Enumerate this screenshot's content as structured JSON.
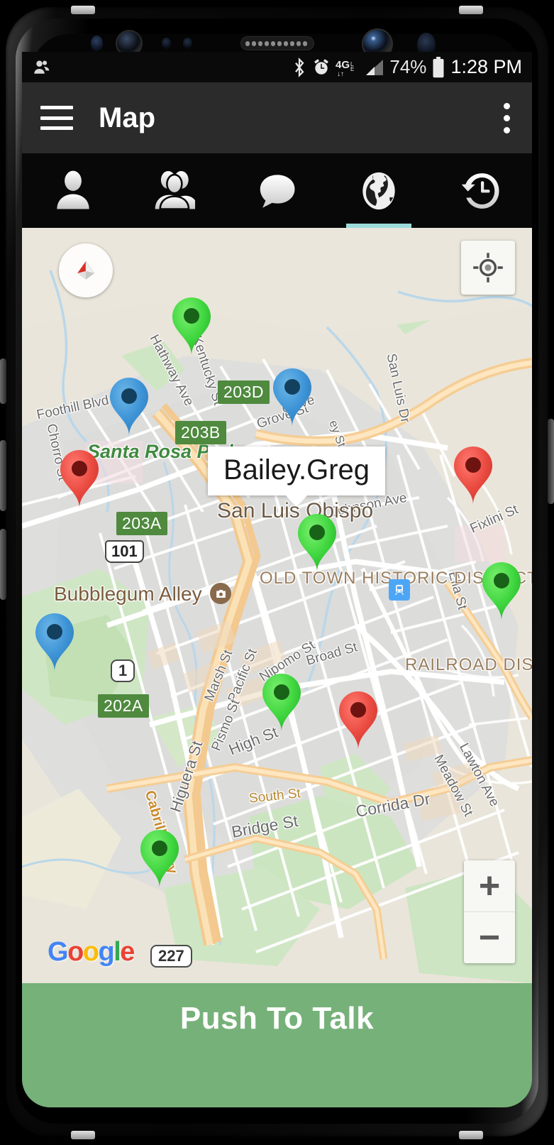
{
  "statusbar": {
    "left_icons": [
      "contacts-icon"
    ],
    "right_icons": [
      "bluetooth-icon",
      "alarm-icon",
      "4g-lte-icon",
      "signal-icon",
      "battery-icon"
    ],
    "network": "4G",
    "battery_percent": "74%",
    "time": "1:28 PM"
  },
  "appbar": {
    "menu_icon": "hamburger-menu-icon",
    "title": "Map",
    "overflow_icon": "overflow-menu-icon"
  },
  "tabs": [
    {
      "name": "person",
      "icon": "person-icon",
      "active": false
    },
    {
      "name": "group",
      "icon": "group-icon",
      "active": false
    },
    {
      "name": "chat",
      "icon": "chat-bubble-icon",
      "active": false
    },
    {
      "name": "map",
      "icon": "globe-icon",
      "active": true
    },
    {
      "name": "history",
      "icon": "history-clock-icon",
      "active": false
    }
  ],
  "map": {
    "info_window": {
      "label": "Bailey.Greg"
    },
    "controls": {
      "compass": "compass-icon",
      "my_location": "my-location-crosshair-icon",
      "zoom_in": "+",
      "zoom_out": "−"
    },
    "attribution": "Google",
    "markers": [
      {
        "color": "green",
        "label": "marker-green-1"
      },
      {
        "color": "blue",
        "label": "marker-blue-1"
      },
      {
        "color": "blue",
        "label": "marker-blue-2"
      },
      {
        "color": "red",
        "label": "marker-red-1"
      },
      {
        "color": "red",
        "label": "marker-red-2"
      },
      {
        "color": "green",
        "label": "marker-green-selected"
      },
      {
        "color": "green",
        "label": "marker-green-2"
      },
      {
        "color": "blue",
        "label": "marker-blue-3"
      },
      {
        "color": "green",
        "label": "marker-green-3"
      },
      {
        "color": "red",
        "label": "marker-red-3"
      },
      {
        "color": "green",
        "label": "marker-green-4"
      }
    ],
    "labels": {
      "places": [
        "Santa Rosa Park",
        "San Luis Obispo",
        "Bubblegum Alley",
        "OLD TOWN HISTORIC DISTRICT",
        "RAILROAD DISTRICT"
      ],
      "streets": [
        "Hathway Ave",
        "Kentucky St",
        "Foothill Blvd",
        "Chorro St",
        "Grove St",
        "San Luis Dr",
        "Johnson Ave",
        "Fixlini St",
        "Ella St",
        "Broad St",
        "Nipomo St",
        "Marsh St",
        "Pacific St",
        "Pismo St",
        "High St",
        "Higuera St",
        "South St",
        "Bridge St",
        "Corrida Dr",
        "Lawton Ave",
        "Meadow St",
        "Cabrillo Hwy",
        "d Ave",
        "ey St"
      ],
      "shields_green": [
        "203D",
        "203B",
        "203A",
        "202A"
      ],
      "shields_white": [
        "1",
        "227"
      ],
      "shields_us": [
        "101"
      ]
    }
  },
  "push_to_talk": {
    "label": "Push To Talk"
  },
  "colors": {
    "accent_tab": "#9bdcda",
    "appbar_bg": "#2b2b2b",
    "ptt_bg": "#76b179",
    "marker_green": "#41d841",
    "marker_blue": "#3d8fd1",
    "marker_red": "#e8453c",
    "shield_green": "#4f8a3f"
  }
}
